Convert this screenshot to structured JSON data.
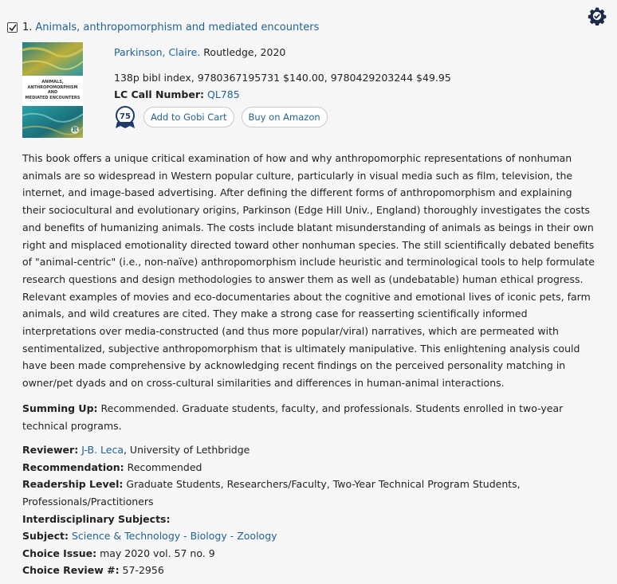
{
  "record": {
    "number": "1.",
    "title": "Animals, anthropomorphism and mediated encounters",
    "author": "Parkinson, Claire.",
    "publisher": "Routledge, 2020",
    "pub_details": "138p bibl index, 9780367195731 $140.00, 9780429203244 $49.95",
    "lc_label": "LC Call Number:",
    "lc_number": "QL785",
    "badge_number": "75",
    "add_cart_label": "Add to Gobi Cart",
    "amazon_label": "Buy on Amazon",
    "checked": true
  },
  "cover": {
    "line1": "ANIMALS,",
    "line2": "ANTHROPOMORPHISM AND",
    "line3": "MEDIATED ENCOUNTERS",
    "publisher_mark": "R"
  },
  "review_text": "This book offers a unique critical examination of how and why anthropomorphic representations of nonhuman animals are so widespread in Western popular culture, particularly in visual media such as film, television, the internet, and image-based advertising. After defining the different forms of anthropomorphism and explaining their sociocultural and evolutionary origins, Parkinson (Edge Hill Univ., England) thoroughly investigates the costs and benefits of humanizing animals. The costs include blatant misunderstanding of animals as beings in their own right and misplaced emotionality directed toward other nonhuman species. The still scientifically debated benefits of \"animal-centric\" (i.e., non-naïve) anthropomorphism include heuristic and terminological tools to help formulate research questions and design methodologies to answer them as well as (undebatable) human ethical progress. Relevant examples of movies and eco-documentaries about the cognitive and emotional lives of iconic pets, farm animals, and wild creatures are cited. They make a strong case for reasserting scientifically informed interpretations over media-constructed (and thus more popular/viral) narratives, which are permeated with sentimentalized, subjective anthropomorphism that is ultimately manipulative. This enlightening analysis could have been made comprehensive by acknowledging recent findings on the perceived personality matching in owner/pet dyads and on cross-cultural similarities and differences in human-animal interactions.",
  "summing_up": {
    "label": "Summing Up:",
    "text": " Recommended. Graduate students, faculty, and professionals. Students enrolled in two-year technical programs."
  },
  "details": {
    "reviewer_label": "Reviewer:",
    "reviewer_name": "J-B. Leca",
    "reviewer_affil": ", University of Lethbridge",
    "recommendation_label": "Recommendation:",
    "recommendation": " Recommended",
    "readership_label": "Readership Level:",
    "readership": " Graduate Students, Researchers/Faculty, Two-Year Technical Program Students, Professionals/Practitioners",
    "interdisciplinary_label": "Interdisciplinary Subjects:",
    "subject_label": "Subject:",
    "subject": "Science & Technology - Biology - Zoology",
    "issue_label": "Choice Issue:",
    "issue": " may 2020 vol. 57 no. 9",
    "review_no_label": "Choice Review #:",
    "review_no": " 57-2956"
  },
  "icons": {
    "settings": "gear-icon",
    "checkbox": "checkbox-icon",
    "badge": "rating-badge-icon"
  },
  "colors": {
    "link": "#1f6396",
    "background": "#f6f6f6",
    "cover_teal": "#2a8a8c",
    "cover_yellow": "#c8b64a"
  }
}
